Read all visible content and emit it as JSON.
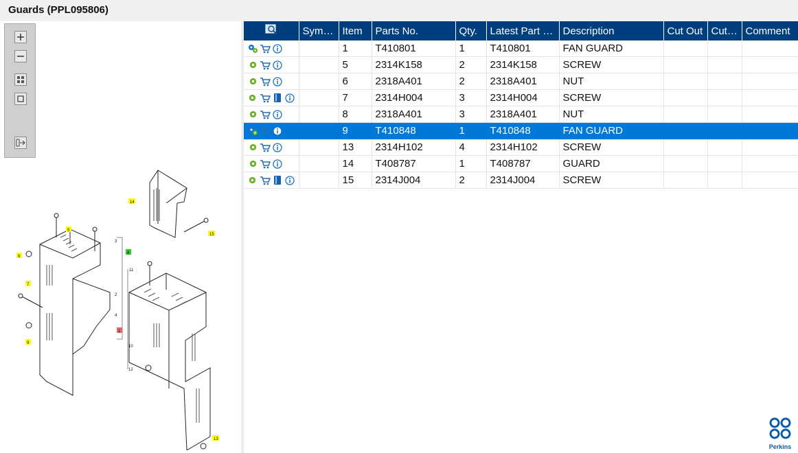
{
  "window": {
    "title": "Guards (PPL095806)"
  },
  "toolbar": {
    "tools": [
      {
        "name": "zoom-in",
        "icon": "plus-icon"
      },
      {
        "name": "zoom-out",
        "icon": "minus-icon"
      },
      {
        "name": "fit-all",
        "icon": "grid-icon"
      },
      {
        "name": "fit-window",
        "icon": "square-icon"
      },
      {
        "name": "export",
        "icon": "export-icon"
      }
    ]
  },
  "drawing": {
    "callouts": [
      "14",
      "5",
      "15",
      "3",
      "8",
      "6",
      "11",
      "7",
      "2",
      "4",
      "1",
      "10",
      "9",
      "12",
      "13"
    ]
  },
  "table": {
    "columns": [
      "",
      "Symb…",
      "Item",
      "Parts No.",
      "Qty.",
      "Latest Part No.",
      "Description",
      "Cut Out",
      "Cut In",
      "Comment"
    ],
    "rows": [
      {
        "icons": [
          "gears-icon",
          "cart-icon",
          "info-icon"
        ],
        "symbol": "",
        "item": "1",
        "part": "T410801",
        "qty": "1",
        "latest": "T410801",
        "desc": "FAN GUARD",
        "selected": false
      },
      {
        "icons": [
          "gear-icon",
          "cart-icon",
          "info-icon"
        ],
        "symbol": "",
        "item": "5",
        "part": "2314K158",
        "qty": "2",
        "latest": "2314K158",
        "desc": "SCREW",
        "selected": false
      },
      {
        "icons": [
          "gear-icon",
          "cart-icon",
          "info-icon"
        ],
        "symbol": "",
        "item": "6",
        "part": "2318A401",
        "qty": "2",
        "latest": "2318A401",
        "desc": "NUT",
        "selected": false
      },
      {
        "icons": [
          "gear-icon",
          "cart-icon",
          "book-icon",
          "info-icon"
        ],
        "symbol": "",
        "item": "7",
        "part": "2314H004",
        "qty": "3",
        "latest": "2314H004",
        "desc": "SCREW",
        "selected": false
      },
      {
        "icons": [
          "gear-icon",
          "cart-icon",
          "info-icon"
        ],
        "symbol": "",
        "item": "8",
        "part": "2318A401",
        "qty": "3",
        "latest": "2318A401",
        "desc": "NUT",
        "selected": false
      },
      {
        "icons": [
          "gears-icon",
          "cart-icon",
          "info-icon"
        ],
        "symbol": "",
        "item": "9",
        "part": "T410848",
        "qty": "1",
        "latest": "T410848",
        "desc": "FAN GUARD",
        "selected": true
      },
      {
        "icons": [
          "gear-icon",
          "cart-icon",
          "info-icon"
        ],
        "symbol": "",
        "item": "13",
        "part": "2314H102",
        "qty": "4",
        "latest": "2314H102",
        "desc": "SCREW",
        "selected": false
      },
      {
        "icons": [
          "gear-icon",
          "cart-icon",
          "info-icon"
        ],
        "symbol": "",
        "item": "14",
        "part": "T408787",
        "qty": "1",
        "latest": "T408787",
        "desc": "GUARD",
        "selected": false
      },
      {
        "icons": [
          "gear-icon",
          "cart-icon",
          "book-icon",
          "info-icon"
        ],
        "symbol": "",
        "item": "15",
        "part": "2314J004",
        "qty": "2",
        "latest": "2314J004",
        "desc": "SCREW",
        "selected": false
      }
    ]
  },
  "brand": {
    "name": "Perkins",
    "color": "#0a5ca8"
  },
  "colors": {
    "header": "#003f7d",
    "selection": "#0078d7",
    "gear": "#6ab023",
    "info": "#1a73c9"
  }
}
